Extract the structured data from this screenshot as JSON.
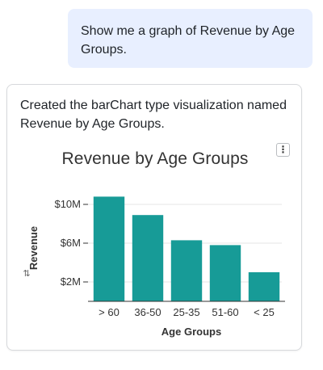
{
  "user_message": "Show me a graph of Revenue by Age Groups.",
  "assistant_message": "Created the barChart type visualization named Revenue by Age Groups.",
  "menu_icon": "⋮",
  "sort_icon": "⇅",
  "colors": {
    "bar": "#179b97",
    "user_bubble": "#e8efff",
    "grid": "#e4e4e4"
  },
  "chart_data": {
    "type": "bar",
    "title": "Revenue by Age Groups",
    "xlabel": "Age Groups",
    "ylabel": "Revenue",
    "categories": [
      "> 60",
      "36-50",
      "25-35",
      "51-60",
      "< 25"
    ],
    "values": [
      10.8,
      8.9,
      6.3,
      5.8,
      3.0
    ],
    "yticks": [
      2,
      6,
      10
    ],
    "ytick_labels": [
      "$2M",
      "$6M",
      "$10M"
    ],
    "ylim": [
      0,
      12
    ],
    "grid": true
  }
}
